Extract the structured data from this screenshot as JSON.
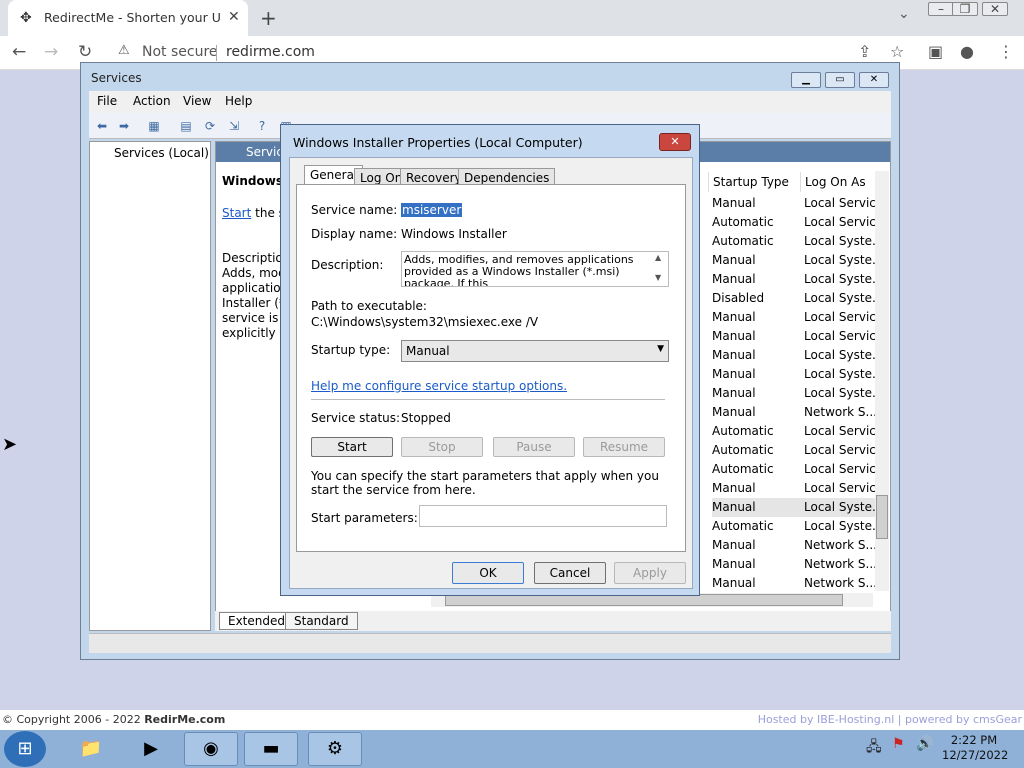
{
  "browser": {
    "tab_title": "RedirectMe - Shorten your URL t",
    "security_label": "Not secure",
    "url": "redirme.com"
  },
  "services_window": {
    "title": "Services",
    "menu": [
      "File",
      "Action",
      "View",
      "Help"
    ],
    "tree_node": "Services (Local)",
    "pane_header": "Servic",
    "desc_title": "Windows In",
    "desc_link": "Start",
    "desc_link_suffix": " the ser",
    "desc_lines": [
      "Description",
      "Adds, modi",
      "application",
      "Installer (*.r",
      "service is di",
      "explicitly de"
    ],
    "columns": [
      "Startup Type",
      "Log On As"
    ],
    "rows": [
      [
        "Manual",
        "Local Service"
      ],
      [
        "Automatic",
        "Local Service"
      ],
      [
        "Automatic",
        "Local Syste..."
      ],
      [
        "Manual",
        "Local Syste..."
      ],
      [
        "Manual",
        "Local Syste..."
      ],
      [
        "Disabled",
        "Local Syste..."
      ],
      [
        "Manual",
        "Local Service"
      ],
      [
        "Manual",
        "Local Service"
      ],
      [
        "Manual",
        "Local Syste..."
      ],
      [
        "Manual",
        "Local Syste..."
      ],
      [
        "Manual",
        "Local Syste..."
      ],
      [
        "Manual",
        "Network S..."
      ],
      [
        "Automatic",
        "Local Service"
      ],
      [
        "Automatic",
        "Local Service"
      ],
      [
        "Automatic",
        "Local Service"
      ],
      [
        "Manual",
        "Local Service"
      ],
      [
        "Manual",
        "Local Syste..."
      ],
      [
        "Automatic",
        "Local Syste..."
      ],
      [
        "Manual",
        "Network S..."
      ],
      [
        "Manual",
        "Network S..."
      ],
      [
        "Manual",
        "Network S..."
      ]
    ],
    "bottom_tabs": [
      "Extended",
      "Standard"
    ]
  },
  "dialog": {
    "title": "Windows Installer Properties (Local Computer)",
    "tabs": [
      "General",
      "Log On",
      "Recovery",
      "Dependencies"
    ],
    "service_name_label": "Service name:",
    "service_name_value": "msiserver",
    "display_name_label": "Display name:",
    "display_name_value": "Windows Installer",
    "description_label": "Description:",
    "description_value": "Adds, modifies, and removes applications provided as a Windows Installer (*.msi) package. If this",
    "path_label": "Path to executable:",
    "path_value": "C:\\Windows\\system32\\msiexec.exe /V",
    "startup_type_label": "Startup type:",
    "startup_type_value": "Manual",
    "help_link": "Help me configure service startup options.",
    "status_label": "Service status:",
    "status_value": "Stopped",
    "buttons": {
      "start": "Start",
      "stop": "Stop",
      "pause": "Pause",
      "resume": "Resume"
    },
    "params_text": "You can specify the start parameters that apply when you start the service from here.",
    "params_label": "Start parameters:",
    "ok": "OK",
    "cancel": "Cancel",
    "apply": "Apply"
  },
  "page": {
    "copyright": "© Copyright 2006 - 2022",
    "copyright_brand": "RedirMe.com",
    "hosted": "Hosted by IBE-Hosting.nl | powered by cmsGear"
  },
  "taskbar": {
    "time": "2:22 PM",
    "date": "12/27/2022"
  }
}
